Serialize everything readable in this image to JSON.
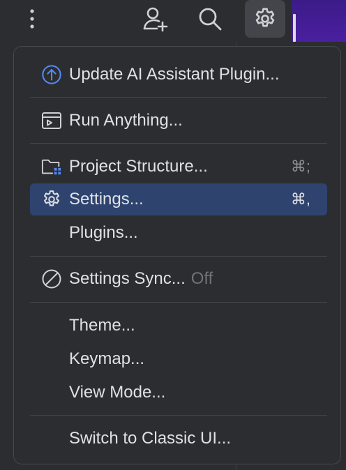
{
  "toolbar": {
    "more_icon": "more-vertical-icon",
    "add_user_icon": "add-user-icon",
    "search_icon": "search-icon",
    "settings_icon": "gear-icon"
  },
  "menu": {
    "items": [
      {
        "label": "Update AI Assistant Plugin...",
        "icon": "upload-arrow-icon"
      },
      {
        "label": "Run Anything...",
        "icon": "run-anything-icon"
      },
      {
        "label": "Project Structure...",
        "icon": "project-structure-icon",
        "shortcut": "⌘;"
      },
      {
        "label": "Settings...",
        "icon": "gear-icon",
        "shortcut": "⌘,",
        "selected": true
      },
      {
        "label": "Plugins..."
      },
      {
        "label": "Settings Sync...",
        "icon": "disabled-icon",
        "status": "Off"
      },
      {
        "label": "Theme..."
      },
      {
        "label": "Keymap..."
      },
      {
        "label": "View Mode..."
      },
      {
        "label": "Switch to Classic UI..."
      }
    ]
  },
  "colors": {
    "background": "#2b2d30",
    "selected": "#2e436e",
    "accent_blue": "#548af7",
    "text": "#dfe1e5",
    "muted": "#6f737a",
    "purple": "#3b1b88"
  }
}
